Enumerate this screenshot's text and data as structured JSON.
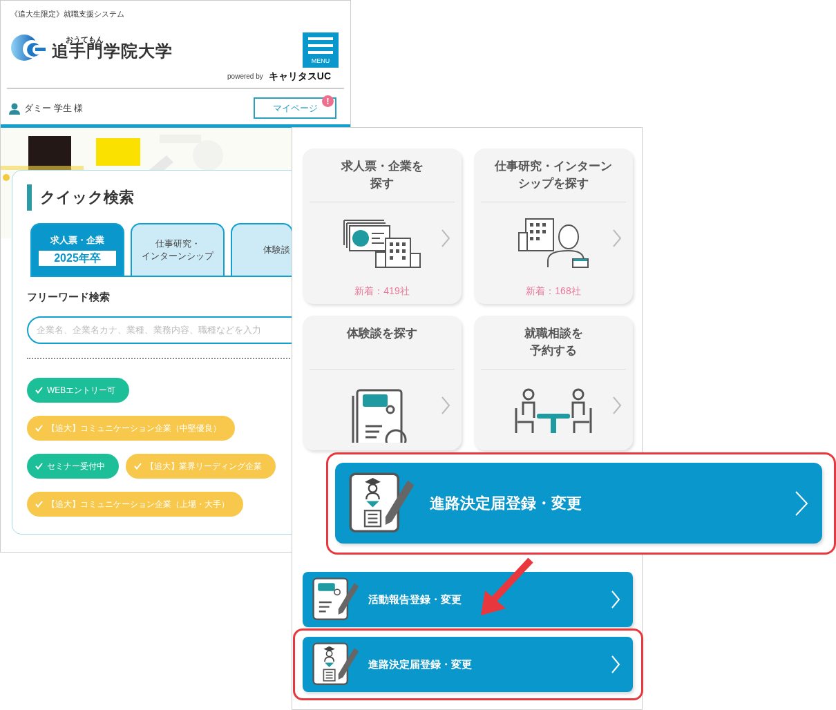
{
  "header": {
    "tagline": "《追大生限定》就職支援システム",
    "university_ruby": "おうてもん",
    "university_name": "追手門学院大学",
    "menu_label": "MENU",
    "powered_by": "powered by",
    "vendor": "キャリタスUC",
    "user_name": "ダミー 学生 様",
    "mypage_button": "マイページ",
    "mypage_alert": "!"
  },
  "quick_search": {
    "title": "クイック検索",
    "tabs": [
      {
        "lines": [
          "求人票・企業"
        ],
        "sublabel": "2025年卒",
        "selected": true
      },
      {
        "lines": [
          "仕事研究・",
          "インターンシップ"
        ],
        "selected": false
      },
      {
        "lines": [
          "体験談"
        ],
        "selected": false
      }
    ],
    "freeword_title": "フリーワード検索",
    "placeholder": "企業名、企業名カナ、業種、業務内容、職種などを入力",
    "tags": [
      {
        "label": "WEBエントリー可",
        "color": "#1dbf98"
      },
      {
        "label": "【追大】コミュニケーション企業（中堅優良）",
        "color": "#f7c84b"
      },
      {
        "label": "セミナー受付中",
        "color": "#1dbf98"
      },
      {
        "label": "【追大】業界リーディング企業",
        "color": "#f7c84b"
      },
      {
        "label": "【追大】コミュニケーション企業（上場・大手）",
        "color": "#f7c84b"
      }
    ]
  },
  "menu_tiles": [
    {
      "lines": [
        "求人票・企業を",
        "探す"
      ],
      "kind": "job-postings",
      "badge": "新着：419社"
    },
    {
      "lines": [
        "仕事研究・インターン",
        "シップを探す"
      ],
      "kind": "internship",
      "badge": "新着：168社"
    },
    {
      "lines": [
        "体験談を探す"
      ],
      "kind": "experiences"
    },
    {
      "lines": [
        "就職相談を",
        "予約する"
      ],
      "kind": "consultation"
    }
  ],
  "callout": {
    "label": "進路決定届登録・変更",
    "kind": "career"
  },
  "action_buttons": [
    {
      "label": "活動報告登録・変更",
      "kind": "report",
      "highlighted": false
    },
    {
      "label": "進路決定届登録・変更",
      "kind": "career",
      "highlighted": true
    }
  ]
}
